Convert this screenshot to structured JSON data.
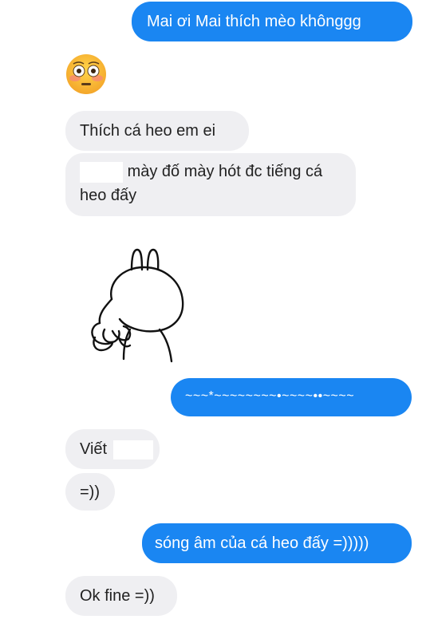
{
  "messages": [
    {
      "id": "m1",
      "side": "sent",
      "text": "Mai ơi Mai thích mèo khônggg"
    },
    {
      "id": "m2",
      "side": "received",
      "emoji": "flushed-face-icon"
    },
    {
      "id": "m3",
      "side": "received",
      "text": "Thích cá heo em ei"
    },
    {
      "id": "m4",
      "side": "received",
      "line1": "mày đố mày hót đc tiếng cá",
      "line2": "heo đấy"
    },
    {
      "id": "m5",
      "side": "received",
      "sticker": "rabbit-sticker"
    },
    {
      "id": "m6",
      "side": "sent",
      "text": "~~~*~~~~~~~~•~~~~••~~~~"
    },
    {
      "id": "m7",
      "side": "received",
      "text": "Viết"
    },
    {
      "id": "m8",
      "side": "received",
      "text": "=))"
    },
    {
      "id": "m9",
      "side": "sent",
      "text": "sóng âm của cá heo đấy =)))))"
    },
    {
      "id": "m10",
      "side": "received",
      "text": "Ok fine =))"
    }
  ],
  "colors": {
    "sent_bubble": "#1a86f2",
    "received_bubble": "#efeff2"
  }
}
